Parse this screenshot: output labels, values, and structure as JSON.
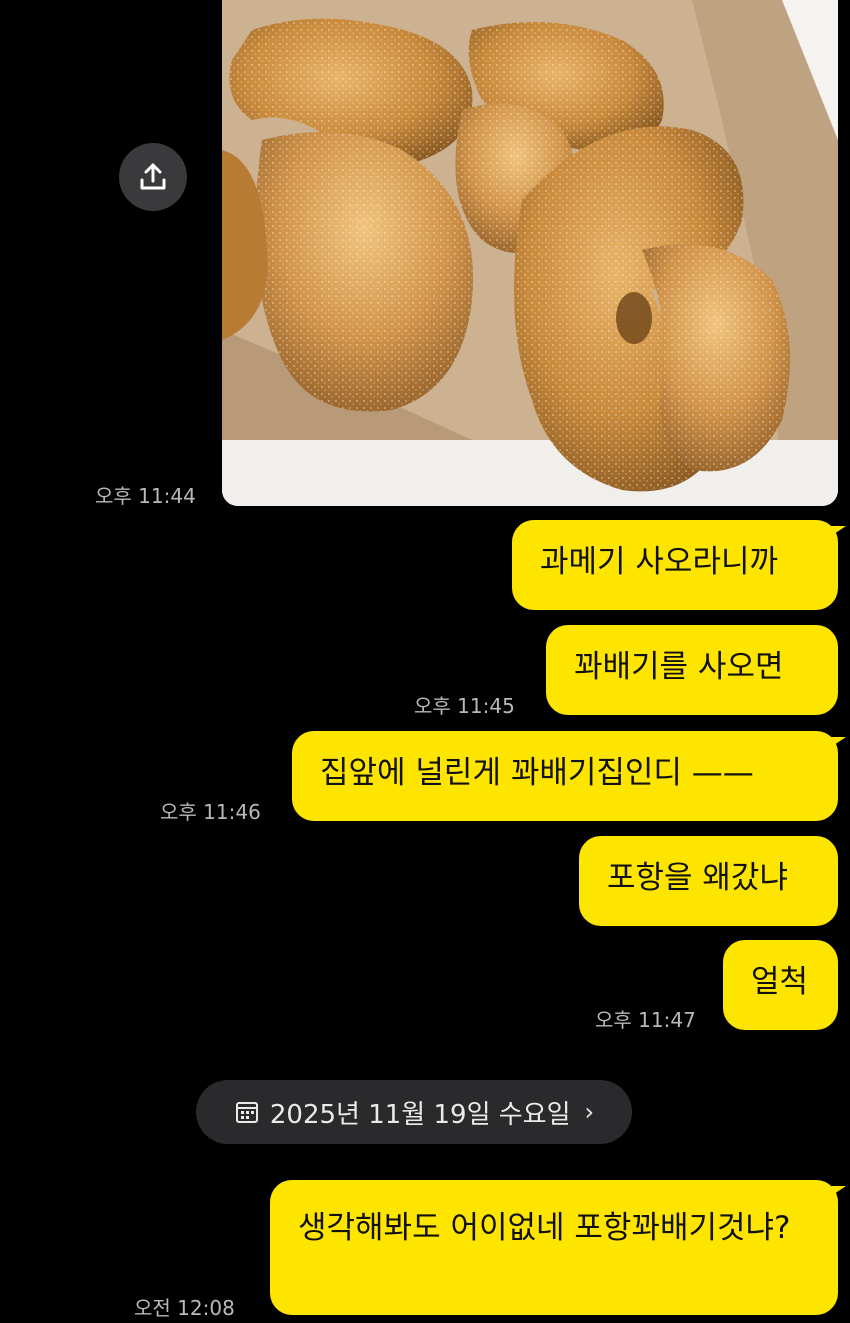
{
  "messages": [
    {
      "type": "photo",
      "time": "오후 11:44",
      "alt": "설탕 묻은 꽈배기 사진"
    },
    {
      "type": "text",
      "text": "과메기 사오라니까"
    },
    {
      "type": "text",
      "text": "꽈배기를 사오면",
      "time": "오후 11:45"
    },
    {
      "type": "text",
      "text": "집앞에 널린게 꽈배기집인디 ——",
      "time": "오후 11:46"
    },
    {
      "type": "text",
      "text": "포항을 왜갔냐"
    },
    {
      "type": "text",
      "text": "얼척",
      "time": "오후 11:47"
    },
    {
      "type": "text",
      "text": "생각해봐도 어이없네 포항꽈배기것냐?",
      "time": "오전 12:08"
    }
  ],
  "date_divider": {
    "label": "2025년 11월 19일 수요일",
    "chevron": "›"
  },
  "icons": {
    "share": "share-upload-icon",
    "calendar": "calendar-icon"
  },
  "colors": {
    "bubble": "#fee500",
    "background": "#000000",
    "timestamp": "#b9b9b9",
    "date_pill": "#2a2a2c"
  }
}
